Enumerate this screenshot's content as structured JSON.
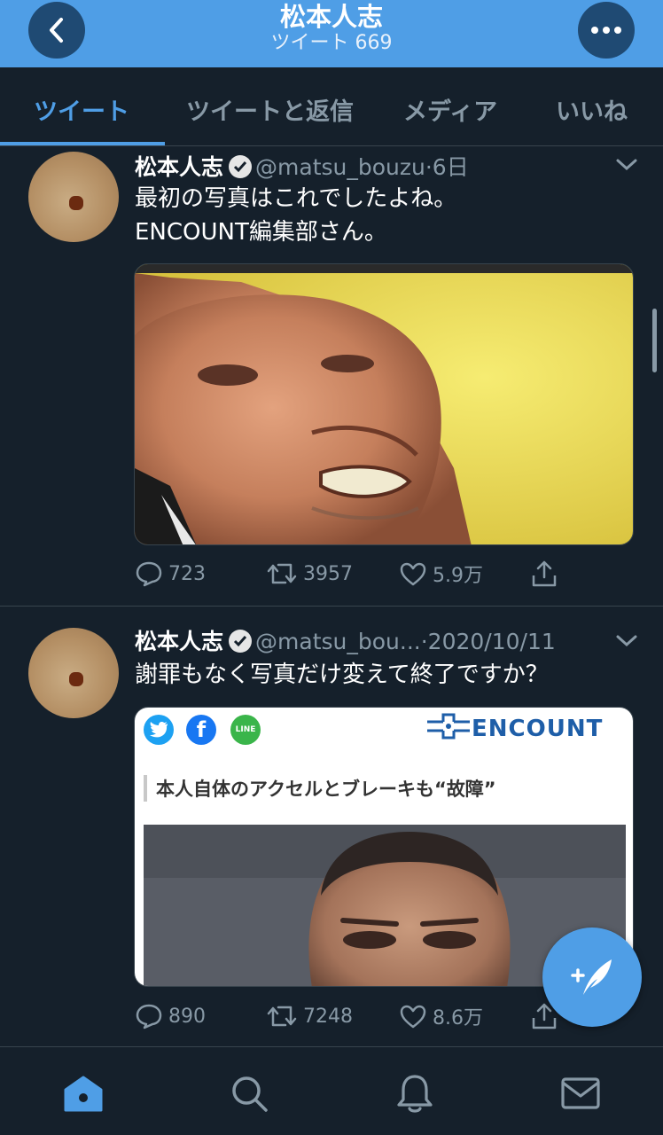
{
  "header": {
    "title": "松本人志",
    "subtitle": "ツイート 669",
    "back_icon": "chevron-left-icon",
    "more_icon": "ellipsis-icon"
  },
  "tabs": [
    {
      "label": "ツイート",
      "active": true
    },
    {
      "label": "ツイートと返信",
      "active": false
    },
    {
      "label": "メディア",
      "active": false
    },
    {
      "label": "いいね",
      "active": false
    }
  ],
  "tweets": [
    {
      "name": "松本人志",
      "handle": "@matsu_bouzu",
      "separator": "·",
      "time": "6日",
      "text_lines": [
        "最初の写真はこれでしたよね。",
        "ENCOUNT編集部さん。"
      ],
      "media": "photo",
      "replies": "723",
      "retweets": "3957",
      "likes": "5.9万"
    },
    {
      "name": "松本人志",
      "handle": "@matsu_bou...",
      "separator": "·",
      "time": "2020/10/11",
      "text_lines": [
        "謝罪もなく写真だけ変えて終了ですか？"
      ],
      "media": "article-card",
      "article": {
        "logo": "ENCOUNT",
        "headline": "本人自体のアクセルとブレーキも“故障”",
        "share_icons": [
          "twitter-icon",
          "facebook-icon",
          "line-icon"
        ],
        "line_label": "LINE"
      },
      "replies": "890",
      "retweets": "7248",
      "likes": "8.6万"
    }
  ],
  "bottom_nav": [
    "home-icon",
    "search-icon",
    "notifications-icon",
    "messages-icon"
  ],
  "colors": {
    "accent": "#4f9ee6",
    "background": "#15202b",
    "muted": "#8899a6",
    "divider": "#38444d"
  }
}
